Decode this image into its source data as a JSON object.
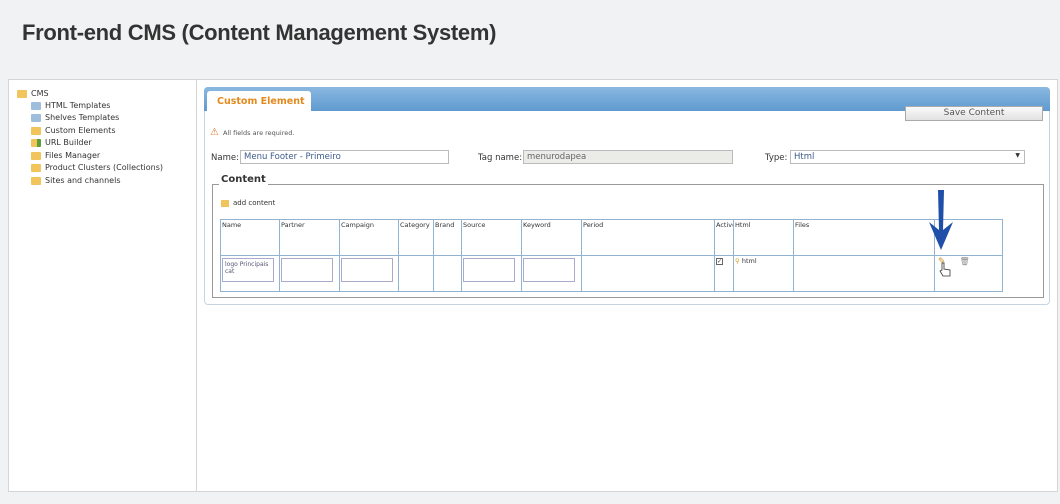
{
  "header": {
    "title": "Front-end CMS (Content Management System)"
  },
  "sidebar": {
    "root": "CMS",
    "items": [
      {
        "label": "HTML Templates",
        "icon": "template-icon"
      },
      {
        "label": "Shelves Templates",
        "icon": "template-icon"
      },
      {
        "label": "Custom Elements",
        "icon": "custom-element-icon"
      },
      {
        "label": "URL Builder",
        "icon": "url-builder-icon"
      },
      {
        "label": "Files Manager",
        "icon": "folder-icon"
      },
      {
        "label": "Product Clusters (Collections)",
        "icon": "folder-icon"
      },
      {
        "label": "Sites and channels",
        "icon": "folder-icon"
      }
    ]
  },
  "form": {
    "tab": "Custom Element",
    "save_label": "Save Content",
    "required_note": "All fields are required.",
    "name_label": "Name:",
    "name_value": "Menu Footer - Primeiro",
    "tag_label": "Tag name:",
    "tag_value": "menurodapea",
    "type_label": "Type:",
    "type_value": "Html",
    "content_legend": "Content",
    "add_content": "add content"
  },
  "table": {
    "columns": [
      "Name",
      "Partner",
      "Campaign",
      "Category",
      "Brand",
      "Source",
      "Keyword",
      "Period",
      "Active",
      "Html",
      "Files",
      ""
    ],
    "row": {
      "name": "logo Principais cat",
      "active": true,
      "html": "html"
    }
  },
  "colors": {
    "accent": "#e48a1c",
    "bar": "#6fa6d6",
    "arrow": "#1f4fa8"
  }
}
